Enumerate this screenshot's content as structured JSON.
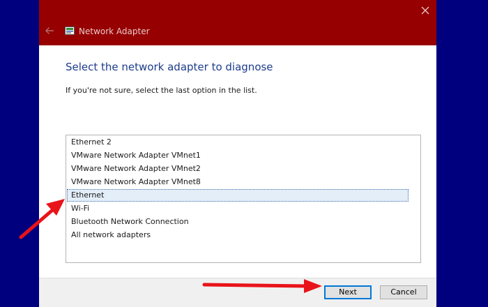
{
  "window": {
    "title": "Network Adapter",
    "titlebar_color": "#960000",
    "background_color": "#00007e"
  },
  "icons": {
    "back": "back-arrow-icon",
    "app": "network-adapter-icon",
    "close": "close-icon"
  },
  "content": {
    "heading": "Select the network adapter to diagnose",
    "subtext": "If you're not sure, select the last option in the list."
  },
  "adapter_list": {
    "selected_index": 4,
    "items": [
      "Ethernet 2",
      "VMware Network Adapter VMnet1",
      "VMware Network Adapter VMnet2",
      "VMware Network Adapter VMnet8",
      "Ethernet",
      "Wi-Fi",
      "Bluetooth Network Connection",
      "All network adapters"
    ]
  },
  "footer": {
    "next_label": "Next",
    "cancel_label": "Cancel"
  },
  "annotations": {
    "arrow_color": "#e8141a",
    "arrows": [
      "pointing-to-ethernet-item",
      "pointing-to-next-button"
    ]
  }
}
